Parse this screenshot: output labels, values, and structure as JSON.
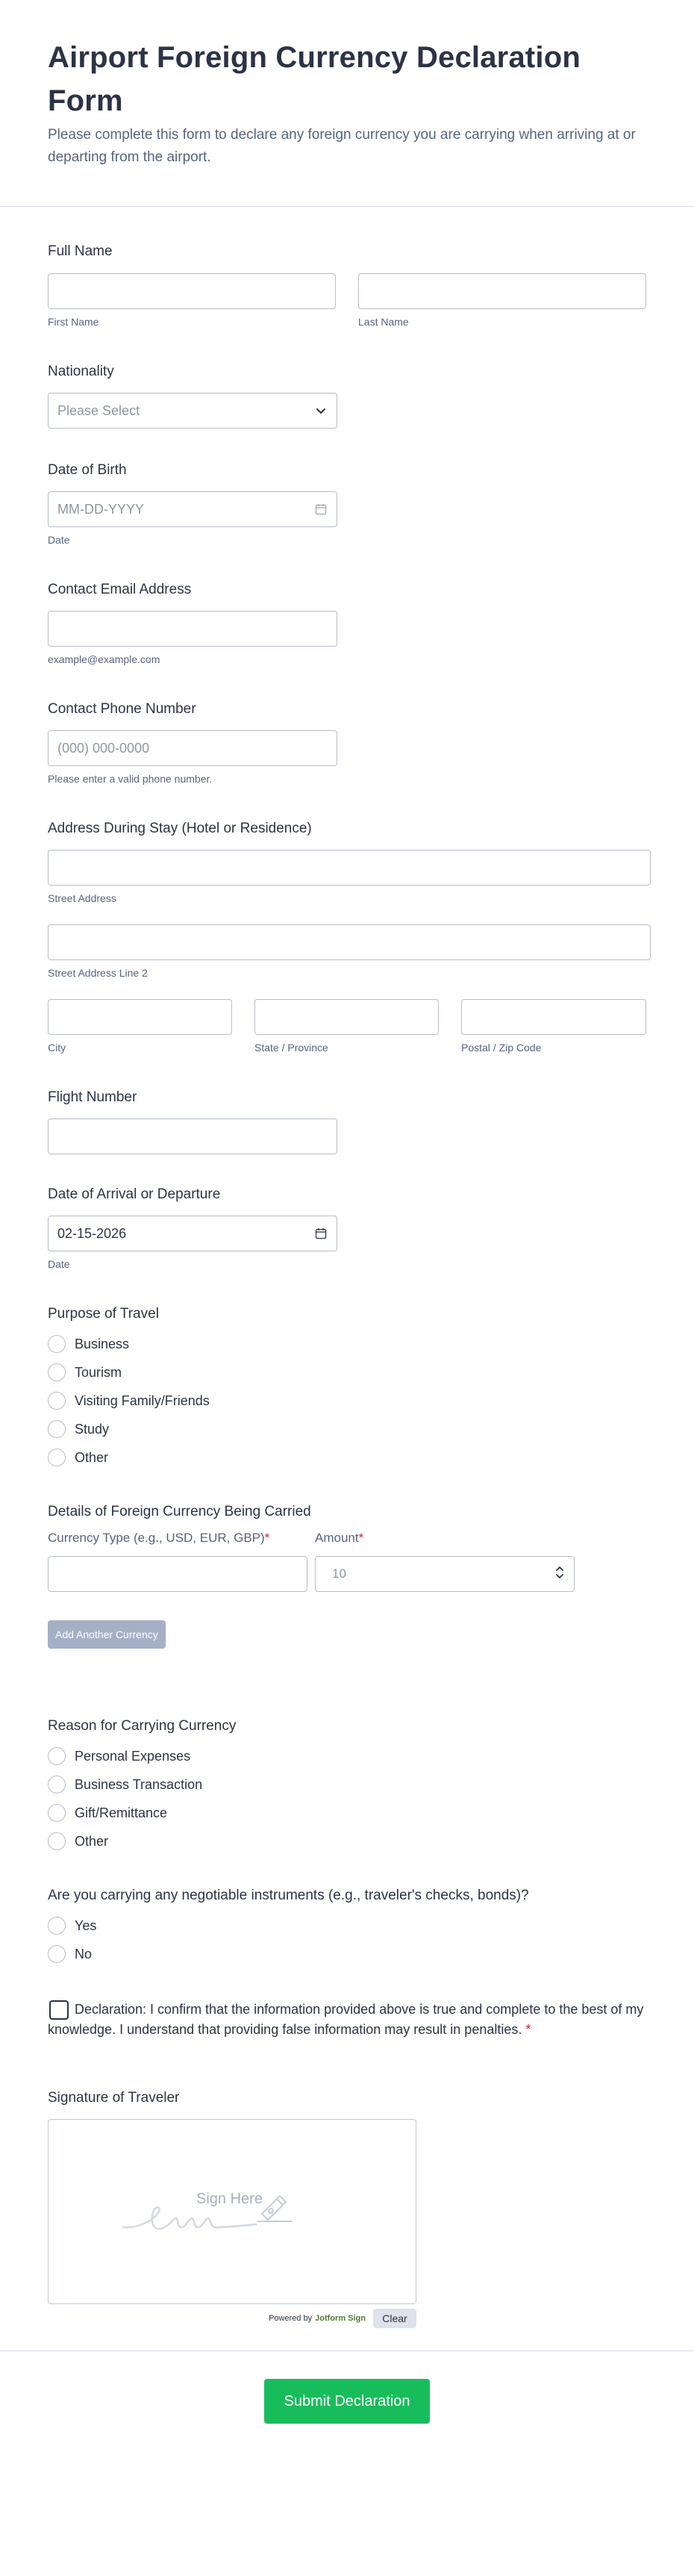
{
  "header": {
    "title": "Airport Foreign Currency Declaration Form",
    "subtitle": "Please complete this form to declare any foreign currency you are carrying when arriving at or departing from the airport."
  },
  "full_name": {
    "label": "Full Name",
    "first_sublabel": "First Name",
    "last_sublabel": "Last Name",
    "first_value": "",
    "last_value": ""
  },
  "nationality": {
    "label": "Nationality",
    "placeholder": "Please Select"
  },
  "dob": {
    "label": "Date of Birth",
    "placeholder": "MM-DD-YYYY",
    "sublabel": "Date"
  },
  "email": {
    "label": "Contact Email Address",
    "sublabel": "example@example.com"
  },
  "phone": {
    "label": "Contact Phone Number",
    "placeholder": "(000) 000-0000",
    "sublabel": "Please enter a valid phone number."
  },
  "address": {
    "label": "Address During Stay (Hotel or Residence)",
    "street_sublabel": "Street Address",
    "street2_sublabel": "Street Address Line 2",
    "city_sublabel": "City",
    "state_sublabel": "State / Province",
    "zip_sublabel": "Postal / Zip Code"
  },
  "flight": {
    "label": "Flight Number"
  },
  "arrival": {
    "label": "Date of Arrival or Departure",
    "value": "02-15-2026",
    "sublabel": "Date"
  },
  "purpose": {
    "label": "Purpose of Travel",
    "options": [
      "Business",
      "Tourism",
      "Visiting Family/Friends",
      "Study",
      "Other"
    ]
  },
  "currency": {
    "label": "Details of Foreign Currency Being Carried",
    "type_label": "Currency Type (e.g., USD, EUR, GBP)",
    "amount_label": "Amount",
    "required_mark": "*",
    "amount_placeholder": "10",
    "add_button": "Add Another Currency"
  },
  "reason": {
    "label": "Reason for Carrying Currency",
    "options": [
      "Personal Expenses",
      "Business Transaction",
      "Gift/Remittance",
      "Other"
    ]
  },
  "instruments": {
    "label": "Are you carrying any negotiable instruments (e.g., traveler's checks, bonds)?",
    "options": [
      "Yes",
      "No"
    ]
  },
  "declaration": {
    "text": "Declaration: I confirm that the information provided above is true and complete to the best of my knowledge. I understand that providing false information may result in penalties.",
    "required_mark": "*"
  },
  "signature": {
    "label": "Signature of Traveler",
    "hint": "Sign Here",
    "powered_by": "Powered by",
    "brand": "Jotform Sign",
    "clear_label": "Clear"
  },
  "submit": {
    "label": "Submit Declaration"
  },
  "colors": {
    "accent": "#18bd5b",
    "required": "#e51d1d",
    "text": "#2c3345",
    "muted": "#57647e",
    "border": "#b8bdc9"
  },
  "icons": {
    "dropdown": "chevron-down-icon",
    "date": "calendar-icon",
    "stepper": "stepper-icon",
    "signature": "pen-icon"
  }
}
